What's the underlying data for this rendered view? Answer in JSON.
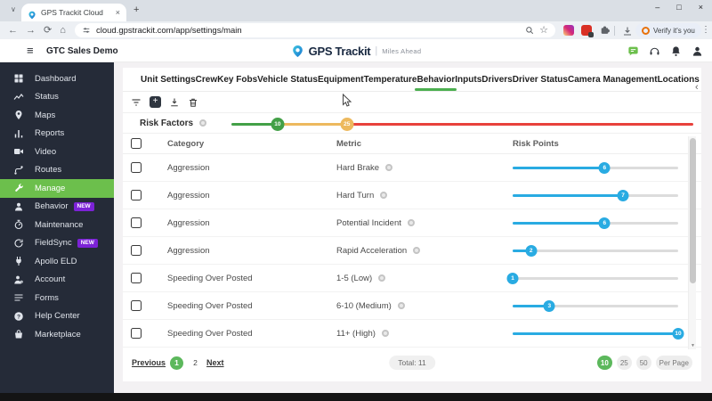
{
  "colors": {
    "accent_green": "#6cbf4c",
    "footer_green": "#5cb85c",
    "tab_underline_green": "#4caf50",
    "slider_blue": "#29abe2",
    "risk_low_green": "#43a047",
    "risk_mid_orange": "#edb95e",
    "risk_high_red": "#e8413c",
    "new_badge_purple": "#7c22d6",
    "sidebar_bg": "#252b38"
  },
  "glyphs": {
    "tab_search": "∨",
    "tab_close": "×",
    "new_tab": "+",
    "back": "←",
    "forward": "→",
    "reload": "⟳",
    "home": "⌂",
    "star": "☆",
    "menu": "⋮",
    "minimize": "–",
    "maximize": "□",
    "window_close": "×",
    "hamburger": "≡",
    "add": "+",
    "tab_scroll_left": "‹",
    "scroll_down": "▼",
    "brand_separator": "|"
  },
  "browser": {
    "tab_title": "GPS Trackit Cloud",
    "url": "cloud.gpstrackit.com/app/settings/main",
    "verify_label": "Verify it's you"
  },
  "header": {
    "org": "GTC Sales Demo",
    "brand": "GPS Trackit",
    "tagline": "Miles Ahead"
  },
  "sidebar": {
    "items": [
      {
        "label": "Dashboard",
        "icon": "dashboard-icon",
        "active": false,
        "badge": ""
      },
      {
        "label": "Status",
        "icon": "status-icon",
        "active": false,
        "badge": ""
      },
      {
        "label": "Maps",
        "icon": "maps-icon",
        "active": false,
        "badge": ""
      },
      {
        "label": "Reports",
        "icon": "reports-icon",
        "active": false,
        "badge": ""
      },
      {
        "label": "Video",
        "icon": "video-icon",
        "active": false,
        "badge": ""
      },
      {
        "label": "Routes",
        "icon": "routes-icon",
        "active": false,
        "badge": ""
      },
      {
        "label": "Manage",
        "icon": "manage-icon",
        "active": true,
        "badge": ""
      },
      {
        "label": "Behavior",
        "icon": "behavior-icon",
        "active": false,
        "badge": "NEW"
      },
      {
        "label": "Maintenance",
        "icon": "maintenance-icon",
        "active": false,
        "badge": ""
      },
      {
        "label": "FieldSync",
        "icon": "fieldsync-icon",
        "active": false,
        "badge": "NEW"
      },
      {
        "label": "Apollo ELD",
        "icon": "apollo-eld-icon",
        "active": false,
        "badge": ""
      },
      {
        "label": "Account",
        "icon": "account-icon",
        "active": false,
        "badge": ""
      },
      {
        "label": "Forms",
        "icon": "forms-icon",
        "active": false,
        "badge": ""
      },
      {
        "label": "Help Center",
        "icon": "help-icon",
        "active": false,
        "badge": ""
      },
      {
        "label": "Marketplace",
        "icon": "marketplace-icon",
        "active": false,
        "badge": ""
      }
    ]
  },
  "tabs": {
    "items": [
      "Unit Settings",
      "Crew",
      "Key Fobs",
      "Vehicle Status",
      "Equipment",
      "Temperature",
      "Behavior",
      "Inputs",
      "Drivers",
      "Driver Status",
      "Camera Management",
      "Locations"
    ],
    "active": "Behavior"
  },
  "toolbar": {
    "icons": [
      "filter-icon",
      "add-icon",
      "download-icon",
      "trash-icon"
    ]
  },
  "risk_factors": {
    "label": "Risk Factors",
    "min": 0,
    "max": 100,
    "low_handle": 10,
    "high_handle": 25
  },
  "table": {
    "columns": [
      "Category",
      "Metric",
      "Risk Points"
    ],
    "slider_min": 1,
    "slider_max": 10,
    "rows": [
      {
        "category": "Aggression",
        "metric": "Hard Brake",
        "risk_points": 6
      },
      {
        "category": "Aggression",
        "metric": "Hard Turn",
        "risk_points": 7
      },
      {
        "category": "Aggression",
        "metric": "Potential Incident",
        "risk_points": 6
      },
      {
        "category": "Aggression",
        "metric": "Rapid Acceleration",
        "risk_points": 2
      },
      {
        "category": "Speeding Over Posted",
        "metric": "1-5 (Low)",
        "risk_points": 1
      },
      {
        "category": "Speeding Over Posted",
        "metric": "6-10 (Medium)",
        "risk_points": 3
      },
      {
        "category": "Speeding Over Posted",
        "metric": "11+ (High)",
        "risk_points": 10
      }
    ]
  },
  "footer": {
    "previous": "Previous",
    "pages": [
      "1",
      "2"
    ],
    "active_page": "1",
    "next": "Next",
    "total": "Total: 11",
    "per_page_options": [
      "10",
      "25",
      "50"
    ],
    "per_page_active": "10",
    "per_page_label": "Per Page"
  }
}
